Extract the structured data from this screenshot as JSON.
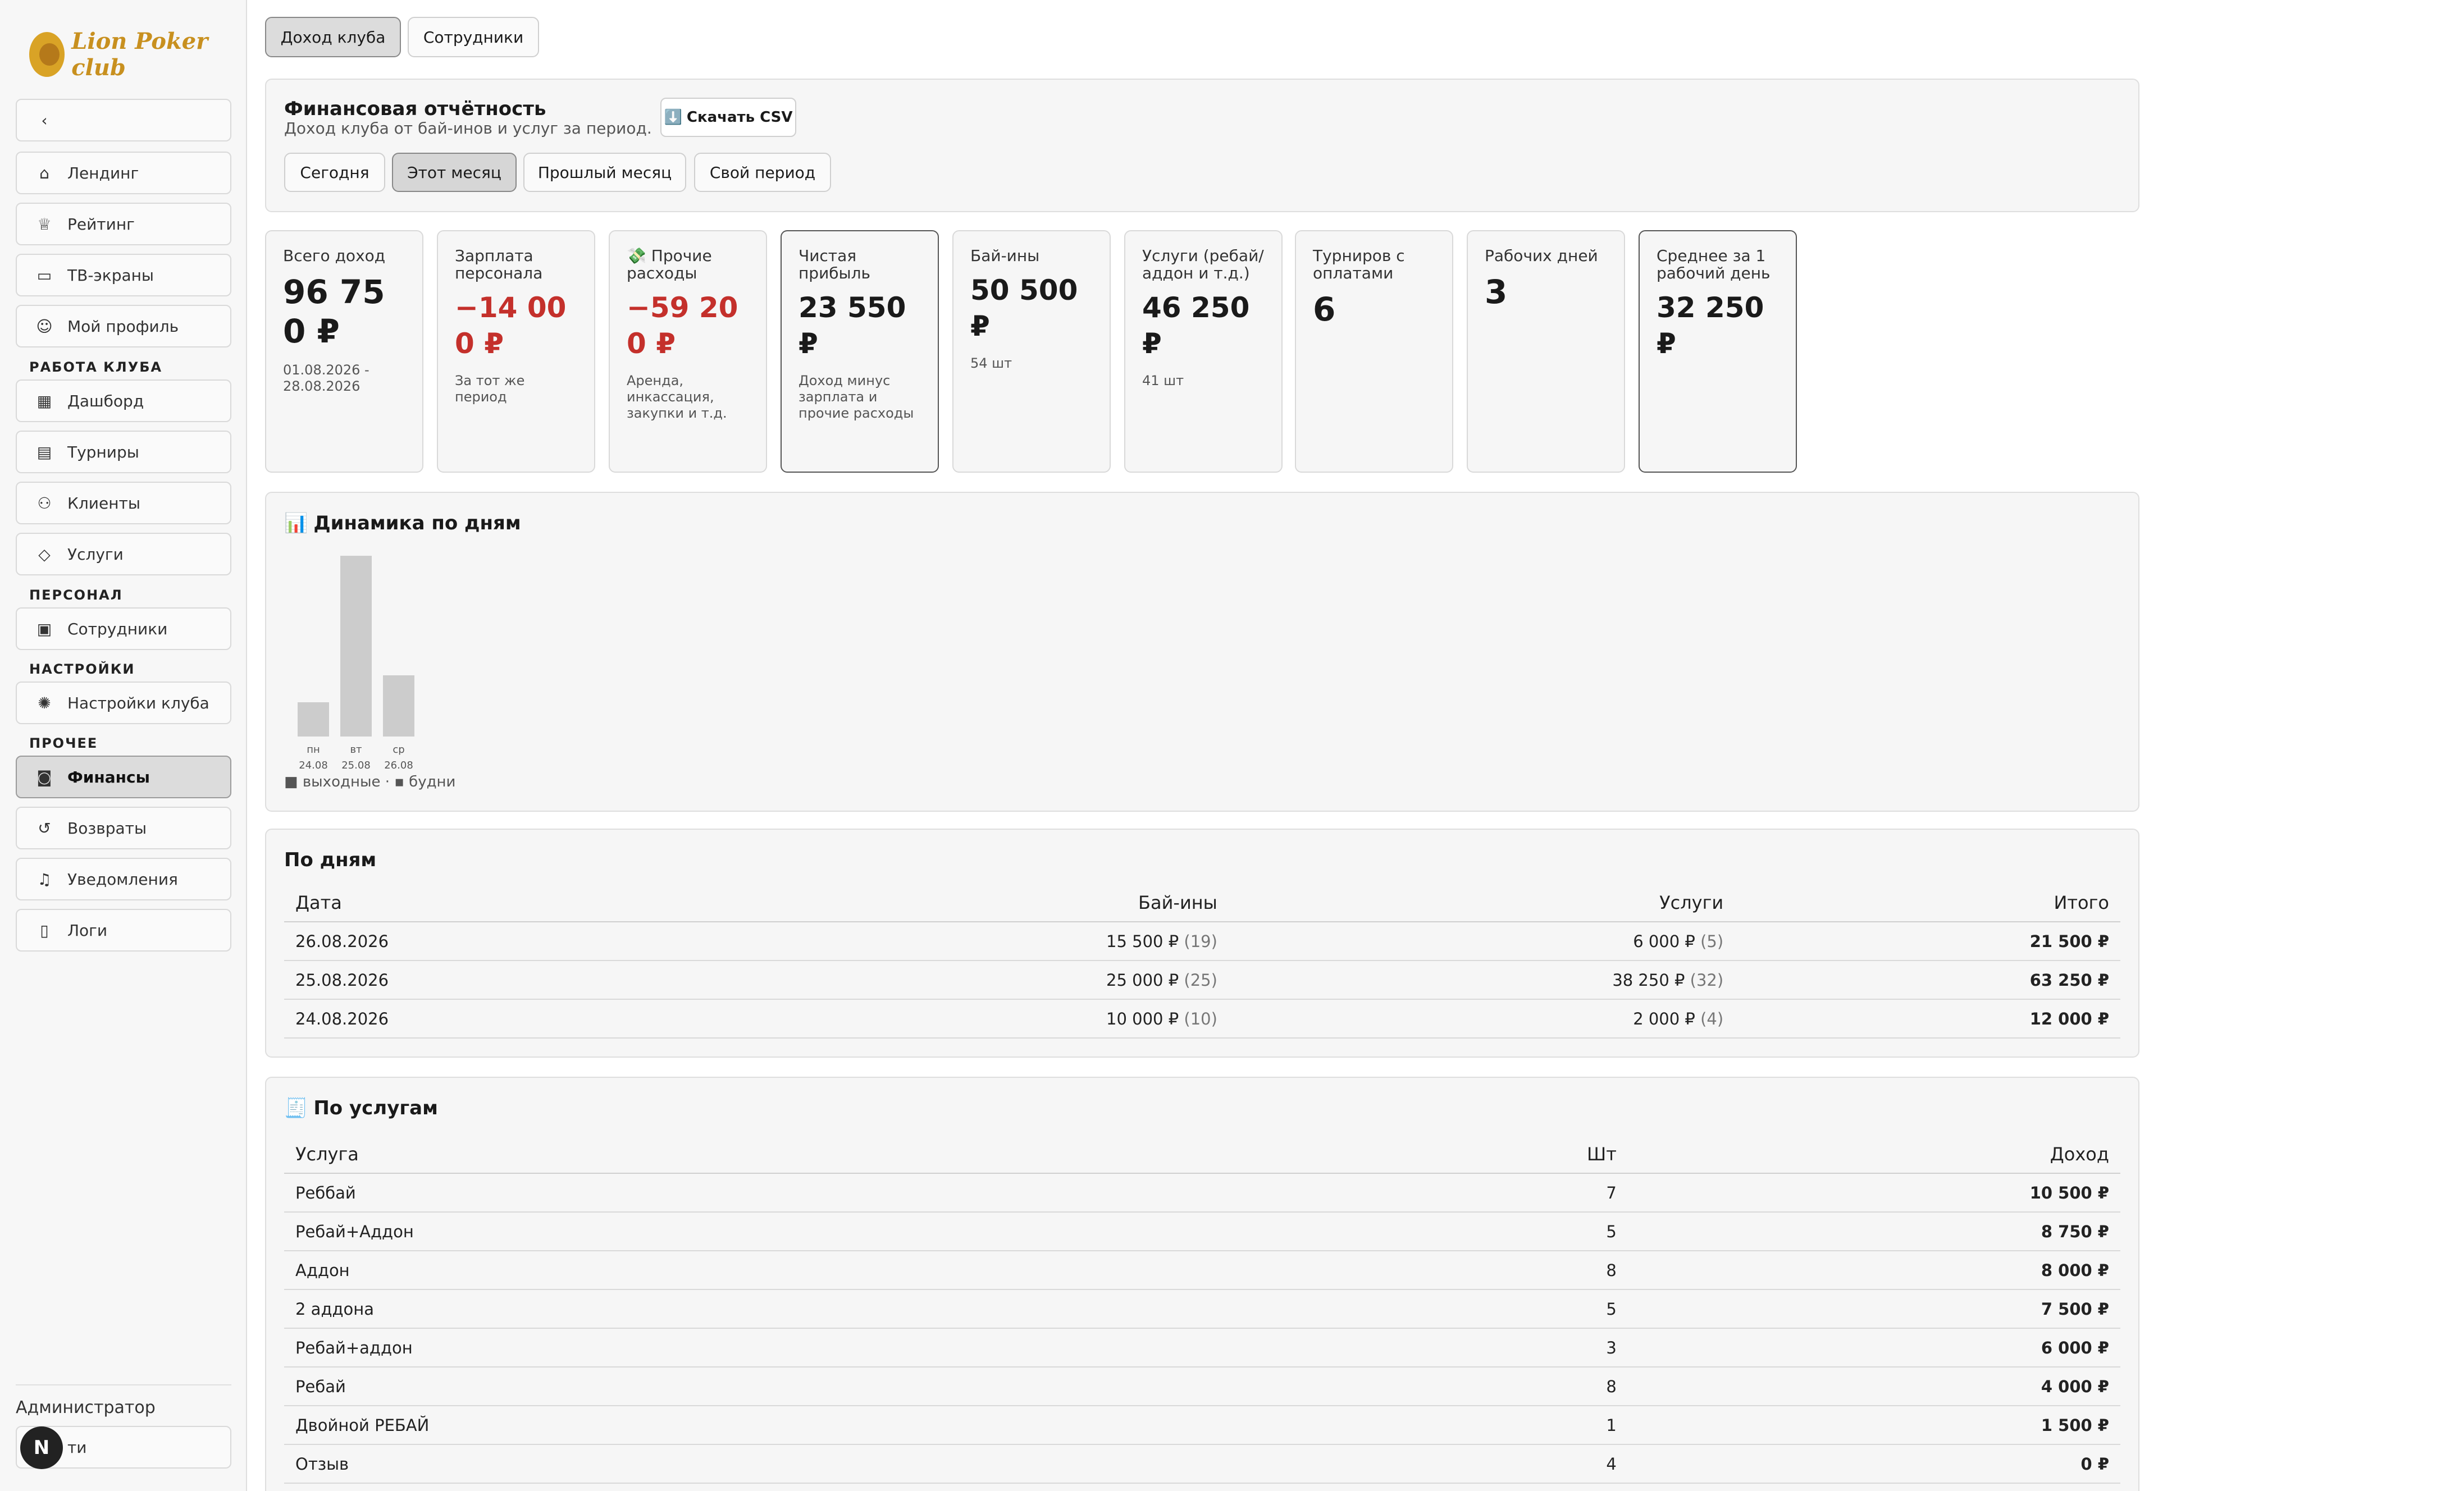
{
  "sidebar": {
    "logo_text": "Lion Poker club",
    "items": [
      {
        "label": "Лендинг",
        "icon": "home-icon"
      },
      {
        "label": "Рейтинг",
        "icon": "trophy-icon"
      },
      {
        "label": "ТВ-экраны",
        "icon": "monitor-icon"
      },
      {
        "label": "Мой профиль",
        "icon": "user-icon"
      },
      {
        "label": "Дашборд",
        "icon": "grid-icon"
      },
      {
        "label": "Турниры",
        "icon": "calendar-icon"
      },
      {
        "label": "Клиенты",
        "icon": "users-icon"
      },
      {
        "label": "Услуги",
        "icon": "tag-icon"
      },
      {
        "label": "Сотрудники",
        "icon": "badge-icon"
      },
      {
        "label": "Настройки клуба",
        "icon": "gear-icon"
      },
      {
        "label": "Финансы",
        "icon": "money-icon"
      },
      {
        "label": "Возвраты",
        "icon": "refund-icon"
      },
      {
        "label": "Уведомления",
        "icon": "bell-icon"
      },
      {
        "label": "Логи",
        "icon": "file-icon"
      }
    ],
    "sections": {
      "club": "РАБОТА КЛУБА",
      "staff": "ПЕРСОНАЛ",
      "settings": "НАСТРОЙКИ",
      "other": "ПРОЧЕЕ"
    },
    "role": "Администратор",
    "logout_label": "ти",
    "badge": "N"
  },
  "tabs": {
    "income": "Доход клуба",
    "employees": "Сотрудники"
  },
  "report": {
    "title": "Финансовая отчётность",
    "subtitle": "Доход клуба от бай-инов и услуг за период.",
    "csv_label": "Скачать CSV",
    "csv_icon": "⬇️",
    "periods": [
      "Сегодня",
      "Этот месяц",
      "Прошлый месяц",
      "Свой период"
    ],
    "active_period": "Этот месяц"
  },
  "stats": [
    {
      "label": "Всего доход",
      "value": "96 750 ₽",
      "note": "01.08.2026 - 28.08.2026"
    },
    {
      "label": "Зарплата персонала",
      "value": "−14 000 ₽",
      "note": "За тот же период"
    },
    {
      "label": "💸 Прочие расходы",
      "value": "−59 200 ₽",
      "note": "Аренда, инкассация, закупки и т.д."
    },
    {
      "label": "Чистая прибыль",
      "value": "23 550 ₽",
      "note": "Доход минус зарплата и прочие расходы"
    },
    {
      "label": "Бай-ины",
      "value": "50 500 ₽",
      "note": "54 шт"
    },
    {
      "label": "Услуги (ребай/аддон и т.д.)",
      "value": "46 250 ₽",
      "note": "41 шт"
    },
    {
      "label": "Турниров с оплатами",
      "value": "6",
      "note": ""
    },
    {
      "label": "Рабочих дней",
      "value": "3",
      "note": ""
    },
    {
      "label": "Среднее за 1 рабочий день",
      "value": "32 250 ₽",
      "note": ""
    }
  ],
  "dynamics": {
    "title": "Динамика по дням",
    "icon": "📊",
    "legend": "■ выходные · ▪ будни"
  },
  "chart_data": {
    "type": "bar",
    "categories": [
      "пн 24.08",
      "вт 25.08",
      "ср 26.08"
    ],
    "day_names": [
      "пн",
      "вт",
      "ср"
    ],
    "dates": [
      "24.08",
      "25.08",
      "26.08"
    ],
    "values": [
      12000,
      63250,
      21500
    ],
    "colors": {
      "weekday": "#cccccc"
    }
  },
  "by_days": {
    "title": "По дням",
    "headers": [
      "Дата",
      "Бай-ины",
      "Услуги",
      "Итого"
    ],
    "rows": [
      {
        "date": "26.08.2026",
        "buyins": "15 500 ₽",
        "buyins_n": "(19)",
        "services": "6 000 ₽",
        "services_n": "(5)",
        "total": "21 500 ₽"
      },
      {
        "date": "25.08.2026",
        "buyins": "25 000 ₽",
        "buyins_n": "(25)",
        "services": "38 250 ₽",
        "services_n": "(32)",
        "total": "63 250 ₽"
      },
      {
        "date": "24.08.2026",
        "buyins": "10 000 ₽",
        "buyins_n": "(10)",
        "services": "2 000 ₽",
        "services_n": "(4)",
        "total": "12 000 ₽"
      }
    ]
  },
  "by_services": {
    "title": "По услугам",
    "icon": "🧾",
    "headers": [
      "Услуга",
      "Шт",
      "Доход"
    ],
    "rows": [
      {
        "name": "Реббай",
        "qty": "7",
        "income": "10 500 ₽"
      },
      {
        "name": "Ребай+Аддон",
        "qty": "5",
        "income": "8 750 ₽"
      },
      {
        "name": "Аддон",
        "qty": "8",
        "income": "8 000 ₽"
      },
      {
        "name": "2 аддона",
        "qty": "5",
        "income": "7 500 ₽"
      },
      {
        "name": "Ребай+аддон",
        "qty": "3",
        "income": "6 000 ₽"
      },
      {
        "name": "Ребай",
        "qty": "8",
        "income": "4 000 ₽"
      },
      {
        "name": "Двойной РЕБАЙ",
        "qty": "1",
        "income": "1 500 ₽"
      },
      {
        "name": "Отзыв",
        "qty": "4",
        "income": "0 ₽"
      }
    ]
  }
}
